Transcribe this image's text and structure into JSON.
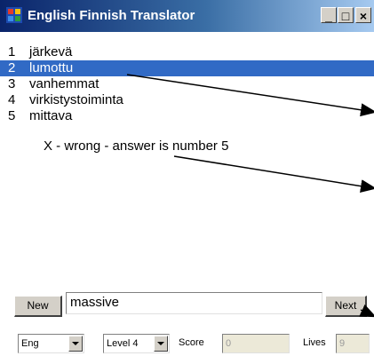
{
  "window": {
    "title": "English Finnish Translator"
  },
  "controls": {
    "minimize": "_",
    "maximize": "□",
    "close": "×"
  },
  "list": [
    {
      "num": "1",
      "word": "järkevä"
    },
    {
      "num": "2",
      "word": "lumottu",
      "selected": true
    },
    {
      "num": "3",
      "word": "vanhemmat"
    },
    {
      "num": "4",
      "word": "virkistystoiminta"
    },
    {
      "num": "5",
      "word": "mittava"
    }
  ],
  "feedback": "X - wrong - answer is number  5",
  "actions": {
    "new_label": "New",
    "next_label": "Next"
  },
  "input": {
    "value": "massive"
  },
  "status": {
    "language": "Eng",
    "level": "Level 4",
    "score_label": "Score",
    "score_value": "0",
    "lives_label": "Lives",
    "lives_value": "9"
  },
  "colors": {
    "selection": "#316ac5",
    "titlebar": "#0a246a"
  }
}
